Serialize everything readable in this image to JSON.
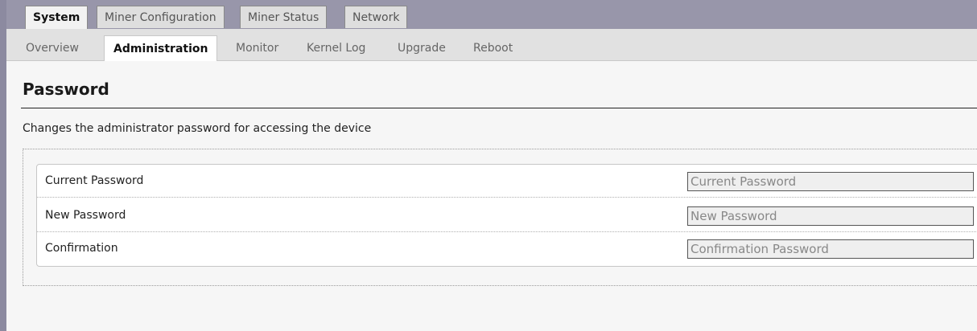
{
  "top_tabs": [
    {
      "label": "System",
      "active": true
    },
    {
      "label": "Miner Configuration",
      "active": false
    },
    {
      "label": "Miner Status",
      "active": false
    },
    {
      "label": "Network",
      "active": false
    }
  ],
  "sub_tabs": [
    {
      "label": "Overview",
      "active": false
    },
    {
      "label": "Administration",
      "active": true
    },
    {
      "label": "Monitor",
      "active": false
    },
    {
      "label": "Kernel Log",
      "active": false
    },
    {
      "label": "Upgrade",
      "active": false
    },
    {
      "label": "Reboot",
      "active": false
    }
  ],
  "section": {
    "title": "Password",
    "description": "Changes the administrator password for accessing the device"
  },
  "fields": [
    {
      "label": "Current Password",
      "placeholder": "Current Password",
      "value": ""
    },
    {
      "label": "New Password",
      "placeholder": "New Password",
      "value": ""
    },
    {
      "label": "Confirmation",
      "placeholder": "Confirmation Password",
      "value": ""
    }
  ],
  "colors": {
    "header_bar": "#9896aa",
    "subtab_bar": "#e1e1e1",
    "page_bg": "#f6f6f6"
  }
}
